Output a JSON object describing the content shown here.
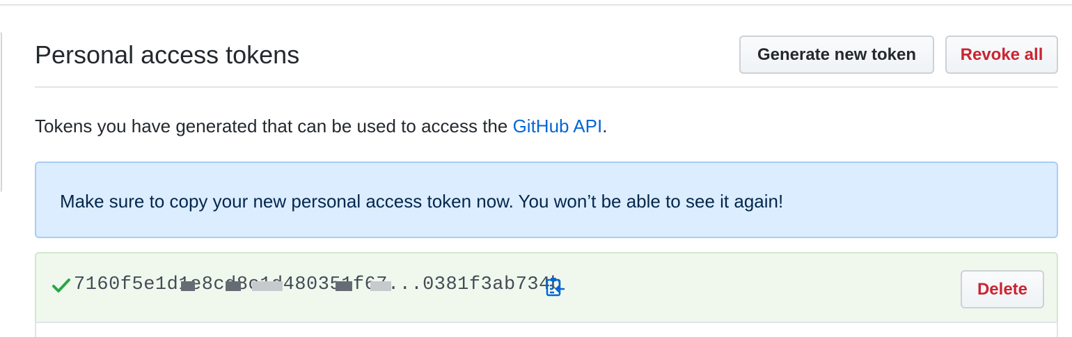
{
  "header": {
    "title": "Personal access tokens",
    "generate_label": "Generate new token",
    "revoke_label": "Revoke all"
  },
  "intro": {
    "text_before": "Tokens you have generated that can be used to access the ",
    "link_text": "GitHub API",
    "text_after": "."
  },
  "flash": {
    "message": "Make sure to copy your new personal access token now. You won’t be able to see it again!"
  },
  "token": {
    "value_visible": "7160f5e1d1e8cd8c1d480351f67...0381f3ab734b",
    "delete_label": "Delete",
    "status_icon": "check-icon",
    "copy_icon": "clipboard-copy-icon"
  },
  "colors": {
    "accent_link": "#0366d6",
    "danger": "#cb2431",
    "success": "#28a745",
    "flash_bg": "#dbedff",
    "token_bg": "#f0f8ee"
  }
}
